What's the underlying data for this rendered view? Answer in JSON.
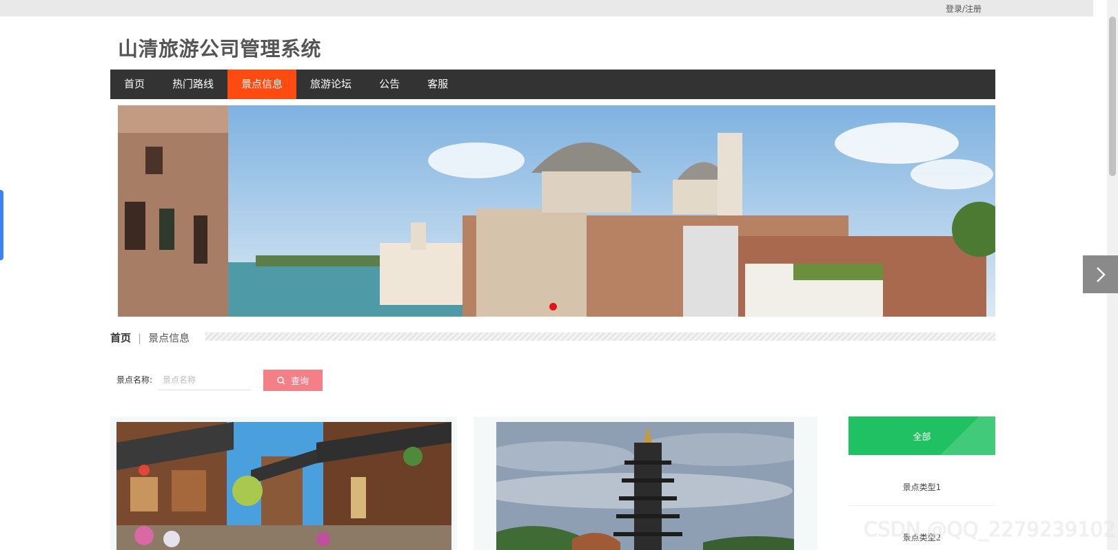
{
  "topbar": {
    "login_label": "登录/注册"
  },
  "site": {
    "title": "山清旅游公司管理系统"
  },
  "nav": {
    "items": [
      {
        "label": "首页"
      },
      {
        "label": "热门路线"
      },
      {
        "label": "景点信息"
      },
      {
        "label": "旅游论坛"
      },
      {
        "label": "公告"
      },
      {
        "label": "客服"
      }
    ],
    "active_index": 2
  },
  "banner": {
    "next_icon": "chevron-right-icon"
  },
  "breadcrumb": {
    "home": "首页",
    "separator": "|",
    "current": "景点信息"
  },
  "search": {
    "label": "景点名称:",
    "placeholder": "景点名称",
    "value": "",
    "button_label": "查询",
    "button_icon": "search-icon"
  },
  "categories": [
    {
      "label": "全部"
    },
    {
      "label": "景点类型1"
    },
    {
      "label": "景点类型2"
    }
  ],
  "watermark": "CSDN @QQ_2279239102",
  "colors": {
    "nav_bg": "#333333",
    "nav_active": "#ff4a11",
    "search_button": "#f47f87",
    "category_active": "#1fc162",
    "banner_dot": "#e51313"
  }
}
